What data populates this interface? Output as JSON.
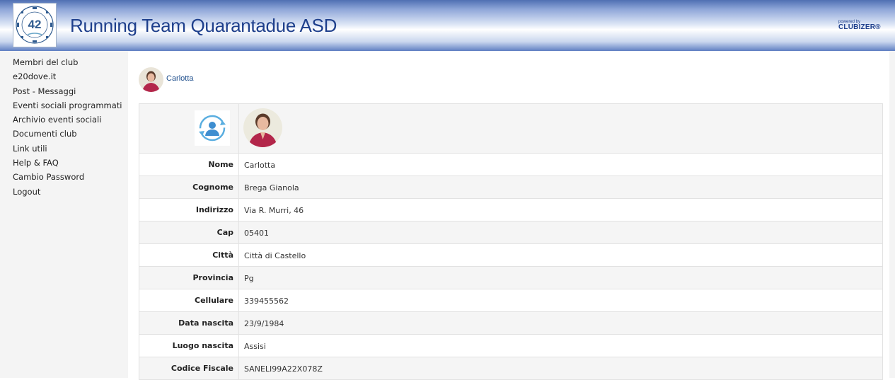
{
  "header": {
    "title": "Running Team Quarantadue ASD",
    "logo": {
      "number": "42",
      "ring_text": "RUNNING TEAM QUARANTADUE"
    },
    "powered_by": "powered by",
    "brand": "CLUBIZER®",
    "colors": {
      "title": "#1e3f8c",
      "banner_dark": "#4f6fb3"
    }
  },
  "sidebar": {
    "items": [
      {
        "label": "Membri del club"
      },
      {
        "label": "e20dove.it"
      },
      {
        "label": "Post - Messaggi"
      },
      {
        "label": "Eventi sociali programmati"
      },
      {
        "label": "Archivio eventi sociali"
      },
      {
        "label": "Documenti club"
      },
      {
        "label": "Link utili"
      },
      {
        "label": "Help & FAQ"
      },
      {
        "label": "Cambio Password"
      },
      {
        "label": "Logout"
      }
    ]
  },
  "user": {
    "name": "Carlotta"
  },
  "profile": {
    "photo_icon": "refresh-user-icon",
    "fields": [
      {
        "label": "Nome",
        "value": "Carlotta"
      },
      {
        "label": "Cognome",
        "value": "Brega Gianola"
      },
      {
        "label": "Indirizzo",
        "value": "Via R. Murri, 46"
      },
      {
        "label": "Cap",
        "value": "05401"
      },
      {
        "label": "Città",
        "value": "Città di Castello"
      },
      {
        "label": "Provincia",
        "value": "Pg"
      },
      {
        "label": "Cellulare",
        "value": "339455562"
      },
      {
        "label": "Data nascita",
        "value": "23/9/1984"
      },
      {
        "label": "Luogo nascita",
        "value": "Assisi"
      },
      {
        "label": "Codice Fiscale",
        "value": "SANELI99A22X078Z"
      }
    ]
  }
}
